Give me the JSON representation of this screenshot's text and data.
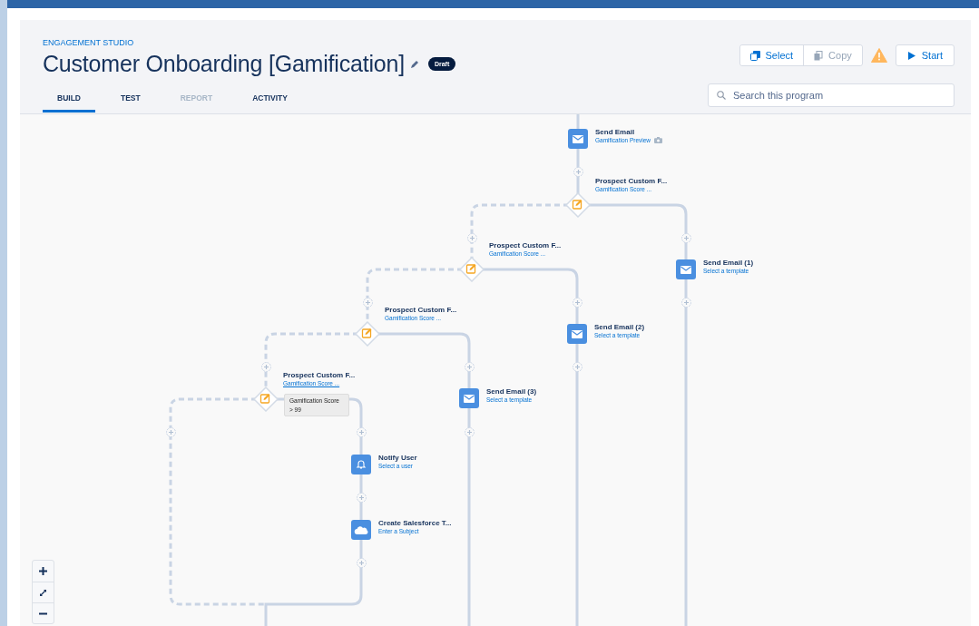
{
  "header": {
    "breadcrumb": "ENGAGEMENT STUDIO",
    "title": "Customer Onboarding [Gamification]",
    "status_badge": "Draft"
  },
  "tabs": [
    {
      "label": "BUILD",
      "selected": true,
      "disabled": false
    },
    {
      "label": "TEST",
      "selected": false,
      "disabled": false
    },
    {
      "label": "REPORT",
      "selected": false,
      "disabled": true
    },
    {
      "label": "ACTIVITY",
      "selected": false,
      "disabled": false
    }
  ],
  "actions": [
    {
      "kind": "select",
      "label": "Select",
      "disabled": false
    },
    {
      "kind": "copy",
      "label": "Copy",
      "disabled": true
    }
  ],
  "warning": true,
  "start_button": {
    "label": "Start"
  },
  "search": {
    "placeholder": "Search this program"
  },
  "canvas": {
    "nodes": [
      {
        "kind": "email",
        "title": "Send Email",
        "subtitle": "Gamification Preview",
        "preview_icon": true,
        "hovered": false
      },
      {
        "kind": "decision",
        "title": "Prospect Custom F...",
        "subtitle": "Gamification Score ...",
        "preview_icon": false,
        "hovered": false
      },
      {
        "kind": "email",
        "title": "Send Email (1)",
        "subtitle": "Select a template",
        "preview_icon": false,
        "hovered": false
      },
      {
        "kind": "decision",
        "title": "Prospect Custom F...",
        "subtitle": "Gamification Score ...",
        "preview_icon": false,
        "hovered": false
      },
      {
        "kind": "email",
        "title": "Send Email (2)",
        "subtitle": "Select a template",
        "preview_icon": false,
        "hovered": false
      },
      {
        "kind": "decision",
        "title": "Prospect Custom F...",
        "subtitle": "Gamification Score ...",
        "preview_icon": false,
        "hovered": false
      },
      {
        "kind": "email",
        "title": "Send Email (3)",
        "subtitle": "Select a template",
        "preview_icon": false,
        "hovered": false
      },
      {
        "kind": "decision",
        "title": "Prospect Custom F...",
        "subtitle": "Gamification Score ...",
        "preview_icon": false,
        "hovered": true
      },
      {
        "kind": "notify",
        "title": "Notify User",
        "subtitle": "Select a user",
        "preview_icon": false,
        "hovered": false
      },
      {
        "kind": "task",
        "title": "Create Salesforce T...",
        "subtitle": "Enter a Subject",
        "preview_icon": false,
        "hovered": false
      }
    ],
    "tooltip": {
      "title": "Gamification Score",
      "condition": "> 99"
    }
  }
}
